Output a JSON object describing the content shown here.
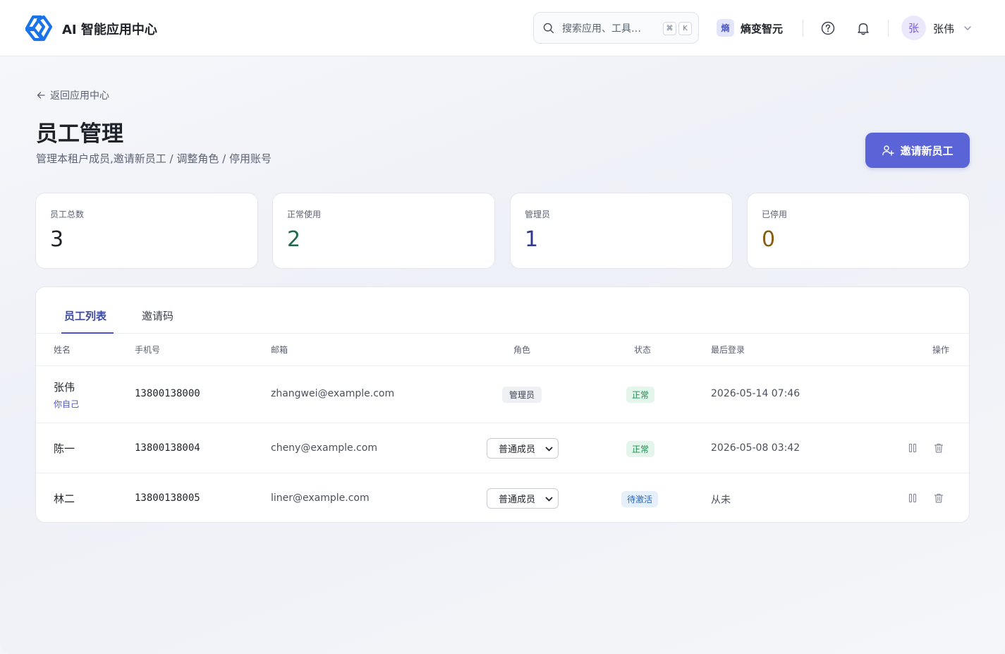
{
  "header": {
    "brand": "AI 智能应用中心",
    "search_placeholder": "搜索应用、工具…",
    "kbd_meta": "⌘",
    "kbd_key": "K",
    "tenant_badge": "熵",
    "tenant_name": "熵变智元",
    "user_avatar": "张",
    "user_name": "张伟",
    "icons": [
      "search-icon",
      "help-icon",
      "bell-icon",
      "chevron-down-icon"
    ]
  },
  "page": {
    "back_label": "返回应用中心",
    "title": "员工管理",
    "subtitle": "管理本租户成员,邀请新员工 / 调整角色 / 停用账号",
    "invite_button": "邀请新员工"
  },
  "stats": [
    {
      "label": "员工总数",
      "value": "3",
      "color": "#1f2329"
    },
    {
      "label": "正常使用",
      "value": "2",
      "color": "#1e6b4a"
    },
    {
      "label": "管理员",
      "value": "1",
      "color": "#2f3a8a"
    },
    {
      "label": "已停用",
      "value": "0",
      "color": "#8a5a12"
    }
  ],
  "tabs": [
    {
      "label": "员工列表",
      "active": true
    },
    {
      "label": "邀请码",
      "active": false
    }
  ],
  "table": {
    "columns": [
      "姓名",
      "手机号",
      "邮箱",
      "角色",
      "状态",
      "最后登录",
      "操作"
    ],
    "rows": [
      {
        "name": "张伟",
        "note": "你自己",
        "phone": "13800138000",
        "email": "zhangwei@example.com",
        "role": "管理员",
        "status": "正常",
        "last_login": "2026-05-14 07:46"
      },
      {
        "name": "陈一",
        "note": "",
        "phone": "13800138004",
        "email": "cheny@example.com",
        "role": "普通成员",
        "status": "正常",
        "last_login": "2026-05-08 03:42"
      },
      {
        "name": "林二",
        "note": "",
        "phone": "13800138005",
        "email": "liner@example.com",
        "role": "普通成员",
        "status": "待激活",
        "last_login": "从未"
      }
    ]
  },
  "colors": {
    "accent": "#5b64d6",
    "status_ok_bg": "#e4f6ec",
    "status_ok_fg": "#1e8a4f",
    "status_pending_bg": "#e6f0fb",
    "status_pending_fg": "#2a64b8"
  }
}
